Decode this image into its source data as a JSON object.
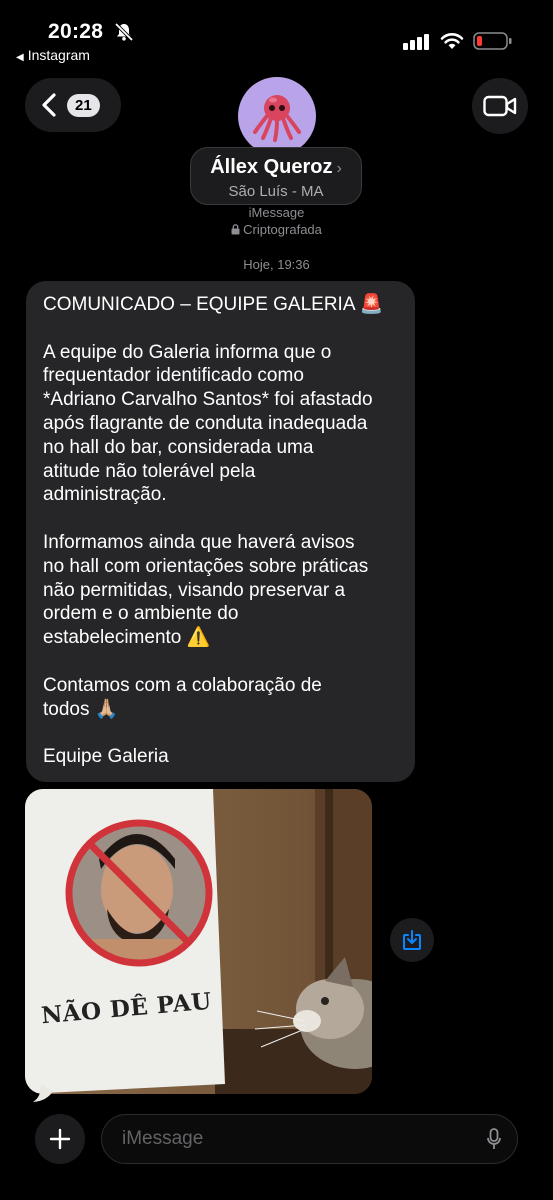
{
  "status": {
    "time": "20:28",
    "back_app": "Instagram"
  },
  "header": {
    "back_badge": "21",
    "contact_name": "Állex Queroz",
    "contact_location": "São Luís - MA",
    "service": "iMessage",
    "encrypted": "Criptografada"
  },
  "conversation": {
    "timestamp": "Hoje, 19:36",
    "message": {
      "title": "COMUNICADO – EQUIPE GALERIA 🚨",
      "p1": "A equipe do Galeria informa que o\nfrequentador identificado como\n*Adriano Carvalho Santos* foi afastado\napós flagrante de conduta inadequada\nno hall do bar, considerada uma\natitude não tolerável pela\nadministração.",
      "p2": "Informamos ainda que haverá avisos\nno hall com orientações sobre práticas\nnão permitidas, visando preservar a\nordem e o ambiente do\nestabelecimento ⚠️",
      "p3": "Contamos com a colaboração de\ntodos 🙏🏼",
      "signature": "Equipe Galeria"
    },
    "image": {
      "sign_text": "NÃO DÊ PAU"
    }
  },
  "composer": {
    "placeholder": "iMessage"
  },
  "colors": {
    "bubble": "#262628",
    "accent_blue": "#0a84ff",
    "battery_low": "#ff3b30",
    "avatar_bg": "#b9a4ea"
  },
  "icons": [
    "bell-slash-icon",
    "signal-icon",
    "wifi-icon",
    "battery-icon",
    "chevron-left-icon",
    "video-camera-icon",
    "octopus-icon",
    "lock-icon",
    "save-download-icon",
    "plus-icon",
    "microphone-icon"
  ]
}
